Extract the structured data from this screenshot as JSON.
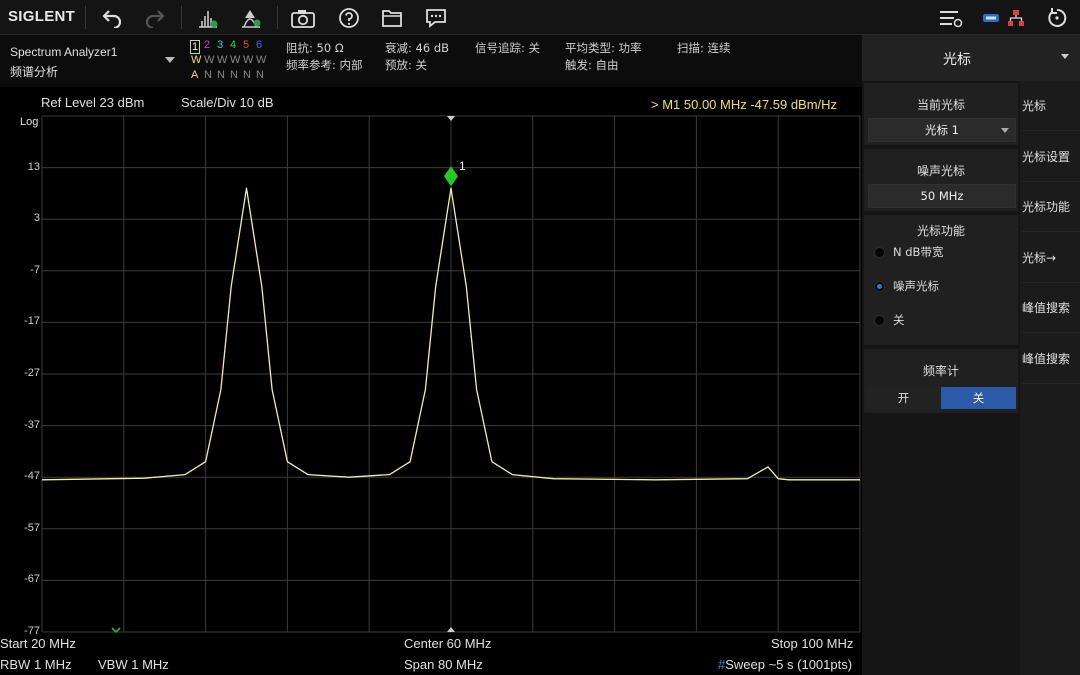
{
  "toolbar": {
    "brand": "SIGLENT",
    "icons": [
      "undo-icon",
      "redo-icon",
      "peak-search-icon",
      "marker-add-icon",
      "screenshot-icon",
      "help-icon",
      "file-icon",
      "message-icon",
      "settings-list-icon",
      "usb-icon",
      "network-icon",
      "reset-icon"
    ]
  },
  "mode": {
    "name": "Spectrum Analyzer1",
    "subtitle": "频谱分析"
  },
  "traces": {
    "numbers": [
      "1",
      "2",
      "3",
      "4",
      "5",
      "6"
    ],
    "number_colors": [
      "#f0f0a0",
      "#d040d0",
      "#40d0d0",
      "#40d040",
      "#e04040",
      "#4060ff"
    ],
    "types": [
      "W",
      "W",
      "W",
      "W",
      "W",
      "W"
    ],
    "type_colors": [
      "#f0e060",
      "#888",
      "#888",
      "#888",
      "#888",
      "#888"
    ],
    "dets": [
      "A",
      "N",
      "N",
      "N",
      "N",
      "N"
    ],
    "det_colors": [
      "#f0e060",
      "#888",
      "#888",
      "#888",
      "#888",
      "#888"
    ]
  },
  "info": {
    "impedance": "阻抗: 50 Ω",
    "freq_ref": "频率参考: 内部",
    "atten": "衰减: 46 dB",
    "preamp": "预放: 关",
    "tracking": "信号追踪: 关",
    "avg_type": "平均类型: 功率",
    "trigger": "触发: 自由",
    "sweep": "扫描: 连续"
  },
  "plot": {
    "ref_level": "Ref Level  23 dBm",
    "scale": "Scale/Div  10 dB",
    "marker_readout": "> M1   50.00 MHz  -47.59 dBm/Hz",
    "log_label": "Log",
    "y_ticks": [
      "13",
      "3",
      "-7",
      "-17",
      "-27",
      "-37",
      "-47",
      "-57",
      "-67",
      "-77"
    ],
    "start": "Start  20 MHz",
    "center": "Center  60 MHz",
    "stop": "Stop  100 MHz",
    "rbw": "RBW  1 MHz",
    "vbw": "VBW  1 MHz",
    "span": "Span  80 MHz",
    "sweep_hash": "#",
    "sweep": "Sweep  ~5 s (1001pts)",
    "marker_label": "1",
    "trace_color": "#f2f0a0",
    "marker_color": "#22cc22",
    "grid_color": "#3c3c3c"
  },
  "chart_data": {
    "type": "line",
    "x_unit": "MHz",
    "y_unit": "dBm",
    "xlim": [
      20,
      100
    ],
    "ylim": [
      -77,
      23
    ],
    "y_scale_per_div": 10,
    "grid": true,
    "series": [
      {
        "x": [
          20,
          30,
          34,
          36,
          37.5,
          38.5,
          40,
          41.5,
          42.5,
          44,
          46,
          50,
          54,
          56,
          57.5,
          58.5,
          60,
          61.5,
          62.5,
          64,
          66,
          70,
          80,
          89,
          91,
          92,
          93,
          100
        ],
        "y": [
          -47.5,
          -47.2,
          -46.5,
          -44,
          -30,
          -10,
          9,
          -10,
          -30,
          -44,
          -46.5,
          -47,
          -46.5,
          -44,
          -30,
          -10,
          9,
          -10,
          -30,
          -44,
          -46.5,
          -47.3,
          -47.5,
          -47.3,
          -45,
          -47.3,
          -47.5,
          -47.5
        ]
      }
    ],
    "markers": [
      {
        "label": "1",
        "x": 60,
        "y": 9
      }
    ]
  },
  "sidebar": {
    "title": "光标",
    "current_marker_label": "当前光标",
    "current_marker_value": "光标 1",
    "noise_marker_label": "噪声光标",
    "noise_marker_value": "50 MHz",
    "marker_func_label": "光标功能",
    "radio_options": [
      "N dB带宽",
      "噪声光标",
      "关"
    ],
    "radio_selected": 1,
    "freq_counter_label": "频率计",
    "toggle_on": "开",
    "toggle_off": "关",
    "toggle_active_color": "#2a5aa8",
    "menu": [
      "光标",
      "光标设置",
      "光标功能",
      "光标→",
      "峰值搜索",
      "峰值搜索"
    ]
  }
}
